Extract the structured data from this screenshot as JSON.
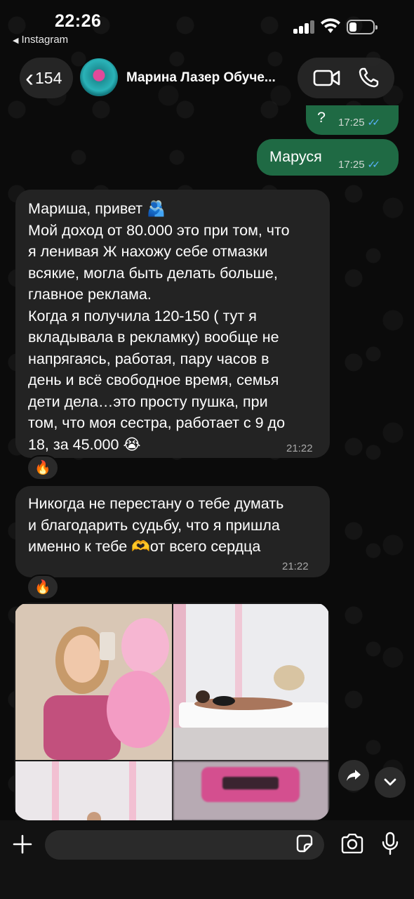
{
  "status_bar": {
    "time": "22:26",
    "back_app": "Instagram"
  },
  "header": {
    "back_count": "154",
    "contact_name": "Марина Лазер Обуче..."
  },
  "messages": [
    {
      "direction": "out",
      "text": "?",
      "time": "17:25",
      "read": true
    },
    {
      "direction": "out",
      "text": "Маруся",
      "time": "17:25",
      "read": true
    },
    {
      "direction": "in",
      "text": "Мариша, привет 🫂\nМой доход от 80.000 это при том, что\nя ленивая Ж нахожу себе отмазки\nвсякие, могла быть делать больше,\nглавное реклама.\nКогда я получила 120-150 ( тут я\nвкладывала в рекламку) вообще не\nнапрягаясь, работая, пару часов в\nдень и всё свободное время, семья\nдети дела…это просту пушка, при\nтом, что моя сестра, работает с 9 до\n18, за 45.000 😭",
      "time": "21:22",
      "reaction": "🔥"
    },
    {
      "direction": "in",
      "text": "Никогда не перестану о тебе думать\nи благодарить судьбу, что я пришла\nименно к тебе 🫶от всего сердца",
      "time": "21:22",
      "reaction": "🔥"
    }
  ],
  "icons": {
    "video": "video-camera-icon",
    "phone": "phone-icon",
    "forward": "forward-arrow-icon",
    "scroll_down": "chevron-down-icon",
    "attach": "plus-icon",
    "sticker": "sticker-icon",
    "camera": "camera-icon",
    "mic": "microphone-icon"
  },
  "colors": {
    "outgoing_bubble": "#1f6a44",
    "incoming_bubble": "#232323",
    "read_ticks": "#5ab4ff"
  },
  "input": {
    "placeholder": "",
    "value": ""
  }
}
